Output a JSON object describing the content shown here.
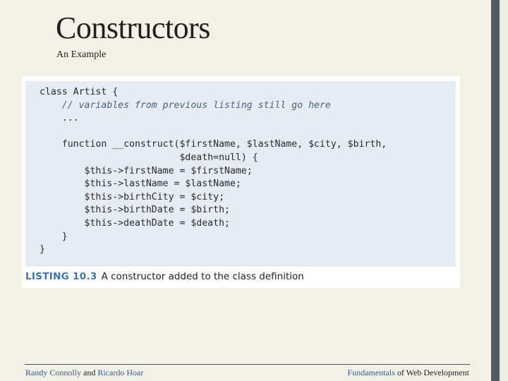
{
  "slide": {
    "title": "Constructors",
    "subtitle": "An Example"
  },
  "listing": {
    "lines": [
      "class Artist {",
      "    // variables from previous listing still go here",
      "    ...",
      "",
      "    function __construct($firstName, $lastName, $city, $birth,",
      "                         $death=null) {",
      "        $this->firstName = $firstName;",
      "        $this->lastName = $lastName;",
      "        $this->birthCity = $city;",
      "        $this->birthDate = $birth;",
      "        $this->deathDate = $death;",
      "    }",
      "}"
    ],
    "caption_number": "LISTING 10.3",
    "caption_text": "A constructor added to the class definition"
  },
  "footer": {
    "author1": "Randy Connolly",
    "and": " and ",
    "author2": "Ricardo Hoar",
    "book_part1": "Fundamentals",
    "book_part2": " of Web Development"
  }
}
